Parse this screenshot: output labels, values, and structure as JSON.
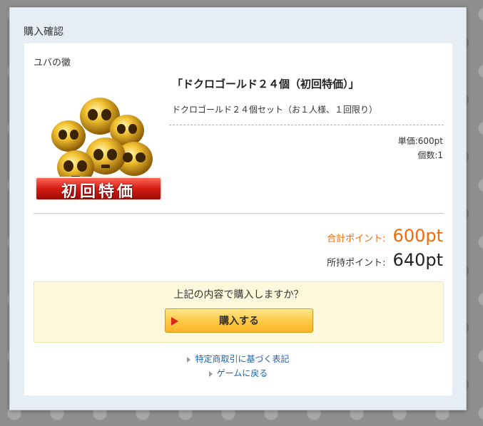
{
  "dialog": {
    "title": "購入確認"
  },
  "shop": {
    "name": "ユバの黴"
  },
  "item": {
    "title": "「ドクロゴールド２４個（初回特価）」",
    "description": "ドクロゴールド２４個セット（お１人様、１回限り）",
    "badge_text": "初回特価",
    "image_icon": "gold-skull-pile-icon",
    "unit_price": "単価:600pt",
    "quantity": "個数:1"
  },
  "points": {
    "total_label": "合計ポイント:",
    "total_value": "600pt",
    "owned_label": "所持ポイント:",
    "owned_value": "640pt"
  },
  "confirm": {
    "question": "上記の内容で購入しますか？",
    "buy_label": "購入する"
  },
  "links": [
    {
      "label": "特定商取引に基づく表記"
    },
    {
      "label": "ゲームに戻る"
    }
  ],
  "colors": {
    "accent": "#f06b0c",
    "link": "#1c63b5",
    "button": "#fec844",
    "badge": "#d32020"
  }
}
